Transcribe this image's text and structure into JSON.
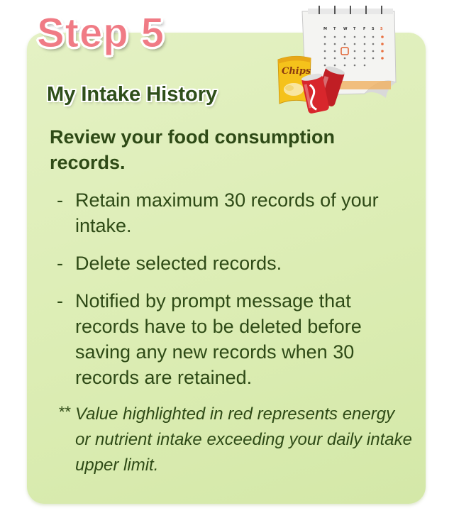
{
  "step": {
    "title": "Step 5",
    "subtitle": "My Intake History"
  },
  "content": {
    "intro": "Review your food consumption records.",
    "bullets": [
      {
        "dash": "-",
        "text": "Retain maximum 30 records of your intake."
      },
      {
        "dash": "-",
        "text": "Delete selected records."
      },
      {
        "dash": "-",
        "text": "Notified by prompt message that records have to be deleted before saving any new records when 30 records are retained."
      }
    ],
    "note": {
      "stars": "**",
      "text": "Value highlighted in red represents energy or nutrient intake exceeding your daily intake upper limit."
    }
  },
  "illustration": {
    "chips_label": "Chips",
    "calendar_icon": "calendar-icon",
    "chips_icon": "chips-bag-icon",
    "can_icon": "soda-can-icon"
  },
  "colors": {
    "card_background": "#dcedb4",
    "title_pink": "#f07b85",
    "text_green": "#2e4a16",
    "can_red": "#d8262c",
    "chips_yellow": "#f5c21b"
  }
}
